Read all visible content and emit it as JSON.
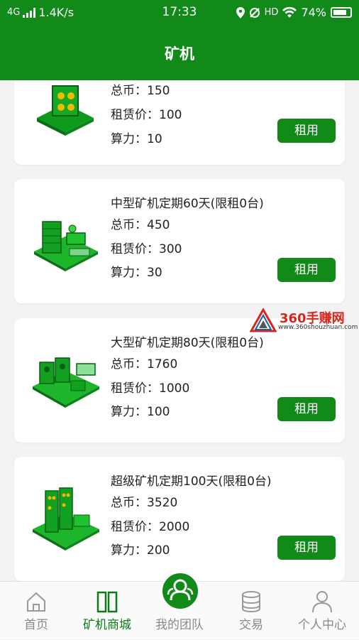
{
  "status_bar": {
    "network": "4G",
    "speed": "1.4K/s",
    "time": "17:33",
    "hd": "HD",
    "battery": "74%"
  },
  "header": {
    "title": "矿机"
  },
  "cards": [
    {
      "title": "",
      "total_label": "总币：",
      "total_value": "150",
      "rent_label": "租赁价：",
      "rent_value": "100",
      "power_label": "算力：",
      "power_value": "10",
      "button": "租用",
      "image": "small-miner-icon"
    },
    {
      "title": "中型矿机定期60天(限租0台)",
      "total_label": "总币：",
      "total_value": "450",
      "rent_label": "租赁价：",
      "rent_value": "300",
      "power_label": "算力：",
      "power_value": "30",
      "button": "租用",
      "image": "medium-miner-icon"
    },
    {
      "title": "大型矿机定期80天(限租0台)",
      "total_label": "总币：",
      "total_value": "1760",
      "rent_label": "租赁价：",
      "rent_value": "1000",
      "power_label": "算力：",
      "power_value": "100",
      "button": "租用",
      "image": "large-miner-icon"
    },
    {
      "title": "超级矿机定期100天(限租0台)",
      "total_label": "总币：",
      "total_value": "3520",
      "rent_label": "租赁价：",
      "rent_value": "2000",
      "power_label": "算力：",
      "power_value": "200",
      "button": "租用",
      "image": "super-miner-icon"
    }
  ],
  "watermark": {
    "text": "360手赚网",
    "url": "www.360shouzhuan.com"
  },
  "tabbar": [
    {
      "label": "首页",
      "icon": "home-icon"
    },
    {
      "label": "矿机商城",
      "icon": "miner-mall-icon",
      "active": true
    },
    {
      "label": "我的团队",
      "icon": "team-icon"
    },
    {
      "label": "交易",
      "icon": "trade-icon"
    },
    {
      "label": "个人中心",
      "icon": "profile-icon"
    }
  ],
  "colors": {
    "primary": "#118a1a",
    "text": "#222222",
    "tab_inactive": "#888888"
  }
}
